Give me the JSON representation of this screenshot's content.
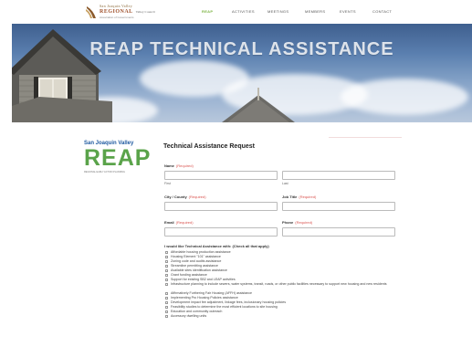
{
  "logo": {
    "line1": "San Joaquin Valley",
    "line2": "REGIONAL",
    "line2_small": "Valley Council",
    "line3": "Association of Governments"
  },
  "nav": {
    "items": [
      {
        "label": "REAP",
        "active": true
      },
      {
        "label": "ACTIVITIES",
        "active": false
      },
      {
        "label": "MEETINGS",
        "active": false
      },
      {
        "label": "MEMBERS",
        "active": false
      },
      {
        "label": "EVENTS",
        "active": false
      },
      {
        "label": "CONTACT",
        "active": false
      }
    ]
  },
  "hero": {
    "title": "REAP TECHNICAL ASSISTANCE"
  },
  "brand": {
    "county": "San Joaquin Valley",
    "word": "REAP",
    "tagline": "REGIONAL EARLY ACTION PLANNING",
    "green": "#5aa34a",
    "blue": "#1f5aa0"
  },
  "form": {
    "title": "Technical Assistance Request",
    "required": "(Required)",
    "name_label": "Name",
    "first": "First",
    "last": "Last",
    "city_label": "City / County",
    "job_label": "Job Title",
    "email_label": "Email",
    "phone_label": "Phone",
    "question": "I would like Technical Assistance with: (Check all that apply)",
    "options": [
      "Affordable housing production assistance",
      "Housing Element \"101\" assistance",
      "Zoning code and audits assistance",
      "Streamline permitting assistance",
      "Available sites identification assistance",
      "Grant funding assistance",
      "Support for existing SB2 and LEAP activities",
      "Infrastructure planning to include sewers, water systems, transit, roads, or other public facilities necessary to support new housing and new residents",
      "Affirmatively Furthering Fair Housing (AFFH) assistance",
      "Implementing Pro Housing Policies assistance",
      "Development impact fee adjustment, linkage fees, inclusionary housing policies",
      "Feasibility studies to determine the most efficient locations to site housing",
      "Education and community outreach",
      "Accessory dwelling units"
    ]
  }
}
